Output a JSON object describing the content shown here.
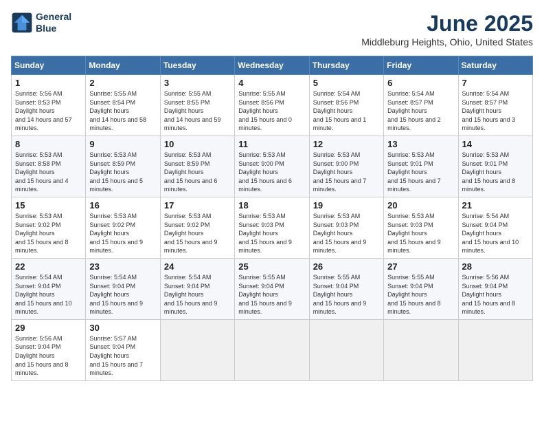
{
  "header": {
    "logo_line1": "General",
    "logo_line2": "Blue",
    "month": "June 2025",
    "location": "Middleburg Heights, Ohio, United States"
  },
  "weekdays": [
    "Sunday",
    "Monday",
    "Tuesday",
    "Wednesday",
    "Thursday",
    "Friday",
    "Saturday"
  ],
  "weeks": [
    [
      {
        "day": "1",
        "sunrise": "5:56 AM",
        "sunset": "8:53 PM",
        "daylight": "14 hours and 57 minutes."
      },
      {
        "day": "2",
        "sunrise": "5:55 AM",
        "sunset": "8:54 PM",
        "daylight": "14 hours and 58 minutes."
      },
      {
        "day": "3",
        "sunrise": "5:55 AM",
        "sunset": "8:55 PM",
        "daylight": "14 hours and 59 minutes."
      },
      {
        "day": "4",
        "sunrise": "5:55 AM",
        "sunset": "8:56 PM",
        "daylight": "15 hours and 0 minutes."
      },
      {
        "day": "5",
        "sunrise": "5:54 AM",
        "sunset": "8:56 PM",
        "daylight": "15 hours and 1 minute."
      },
      {
        "day": "6",
        "sunrise": "5:54 AM",
        "sunset": "8:57 PM",
        "daylight": "15 hours and 2 minutes."
      },
      {
        "day": "7",
        "sunrise": "5:54 AM",
        "sunset": "8:57 PM",
        "daylight": "15 hours and 3 minutes."
      }
    ],
    [
      {
        "day": "8",
        "sunrise": "5:53 AM",
        "sunset": "8:58 PM",
        "daylight": "15 hours and 4 minutes."
      },
      {
        "day": "9",
        "sunrise": "5:53 AM",
        "sunset": "8:59 PM",
        "daylight": "15 hours and 5 minutes."
      },
      {
        "day": "10",
        "sunrise": "5:53 AM",
        "sunset": "8:59 PM",
        "daylight": "15 hours and 6 minutes."
      },
      {
        "day": "11",
        "sunrise": "5:53 AM",
        "sunset": "9:00 PM",
        "daylight": "15 hours and 6 minutes."
      },
      {
        "day": "12",
        "sunrise": "5:53 AM",
        "sunset": "9:00 PM",
        "daylight": "15 hours and 7 minutes."
      },
      {
        "day": "13",
        "sunrise": "5:53 AM",
        "sunset": "9:01 PM",
        "daylight": "15 hours and 7 minutes."
      },
      {
        "day": "14",
        "sunrise": "5:53 AM",
        "sunset": "9:01 PM",
        "daylight": "15 hours and 8 minutes."
      }
    ],
    [
      {
        "day": "15",
        "sunrise": "5:53 AM",
        "sunset": "9:02 PM",
        "daylight": "15 hours and 8 minutes."
      },
      {
        "day": "16",
        "sunrise": "5:53 AM",
        "sunset": "9:02 PM",
        "daylight": "15 hours and 9 minutes."
      },
      {
        "day": "17",
        "sunrise": "5:53 AM",
        "sunset": "9:02 PM",
        "daylight": "15 hours and 9 minutes."
      },
      {
        "day": "18",
        "sunrise": "5:53 AM",
        "sunset": "9:03 PM",
        "daylight": "15 hours and 9 minutes."
      },
      {
        "day": "19",
        "sunrise": "5:53 AM",
        "sunset": "9:03 PM",
        "daylight": "15 hours and 9 minutes."
      },
      {
        "day": "20",
        "sunrise": "5:53 AM",
        "sunset": "9:03 PM",
        "daylight": "15 hours and 9 minutes."
      },
      {
        "day": "21",
        "sunrise": "5:54 AM",
        "sunset": "9:04 PM",
        "daylight": "15 hours and 10 minutes."
      }
    ],
    [
      {
        "day": "22",
        "sunrise": "5:54 AM",
        "sunset": "9:04 PM",
        "daylight": "15 hours and 10 minutes."
      },
      {
        "day": "23",
        "sunrise": "5:54 AM",
        "sunset": "9:04 PM",
        "daylight": "15 hours and 9 minutes."
      },
      {
        "day": "24",
        "sunrise": "5:54 AM",
        "sunset": "9:04 PM",
        "daylight": "15 hours and 9 minutes."
      },
      {
        "day": "25",
        "sunrise": "5:55 AM",
        "sunset": "9:04 PM",
        "daylight": "15 hours and 9 minutes."
      },
      {
        "day": "26",
        "sunrise": "5:55 AM",
        "sunset": "9:04 PM",
        "daylight": "15 hours and 9 minutes."
      },
      {
        "day": "27",
        "sunrise": "5:55 AM",
        "sunset": "9:04 PM",
        "daylight": "15 hours and 8 minutes."
      },
      {
        "day": "28",
        "sunrise": "5:56 AM",
        "sunset": "9:04 PM",
        "daylight": "15 hours and 8 minutes."
      }
    ],
    [
      {
        "day": "29",
        "sunrise": "5:56 AM",
        "sunset": "9:04 PM",
        "daylight": "15 hours and 8 minutes."
      },
      {
        "day": "30",
        "sunrise": "5:57 AM",
        "sunset": "9:04 PM",
        "daylight": "15 hours and 7 minutes."
      },
      null,
      null,
      null,
      null,
      null
    ]
  ]
}
